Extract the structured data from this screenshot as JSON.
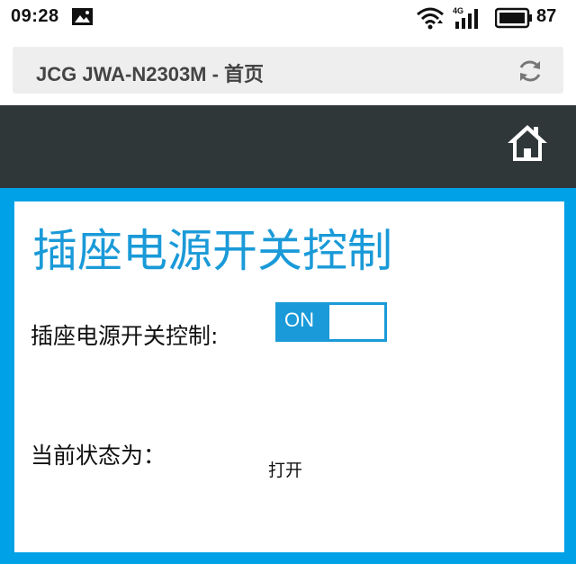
{
  "status_bar": {
    "time": "09:28",
    "network_type": "4G",
    "battery": "87"
  },
  "address_bar": {
    "title": "JCG JWA-N2303M - 首页"
  },
  "header": {
    "home_icon": "home-icon"
  },
  "main": {
    "heading": "插座电源开关控制",
    "power_control": {
      "label": "插座电源开关控制:",
      "toggle_label": "ON",
      "toggle_state": "on"
    },
    "current_state": {
      "label": "当前状态为：",
      "value": "打开"
    }
  },
  "colors": {
    "accent": "#1a9ad8",
    "frame_blue": "#00a1e6",
    "header_bg": "#2f3739",
    "address_bg": "#eeeeee"
  }
}
